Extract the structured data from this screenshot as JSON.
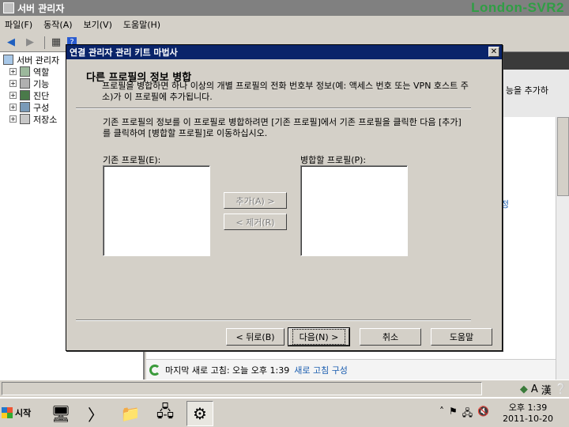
{
  "window": {
    "title": "서버 관리자",
    "watermark": "London-SVR2"
  },
  "menu": [
    "파일(F)",
    "동작(A)",
    "보기(V)",
    "도움말(H)"
  ],
  "tree": {
    "root": "서버 관리자",
    "items": [
      "역할",
      "기능",
      "진단",
      "구성",
      "저장소"
    ]
  },
  "rightpane": {
    "band_text": "능을 추가하",
    "link_text": "정",
    "footer": {
      "refresh_text": "마지막 새로 고침: 오늘 오후 1:39",
      "configure_link": "새로 고침 구성"
    }
  },
  "dialog": {
    "title": "연결 관리자 관리 키트 마법사",
    "heading": "다른 프로필의 정보 병합",
    "description": "프로필을 병합하면 하나 이상의 개별 프로필의 전화 번호부 정보(예: 액세스 번호 또는 VPN 호스트 주소)가 이 프로필에 추가됩니다.",
    "instruction": "기존 프로필의 정보를 이 프로필로 병합하려면 [기존 프로필]에서 기존 프로필을 클릭한 다음 [추가]를 클릭하여 [병합할 프로필]로 이동하십시오.",
    "existing_label": "기존 프로필(E):",
    "merge_label": "병합할 프로필(P):",
    "add_button": "추가(A) >",
    "remove_button": "< 제거(R)",
    "back_button": "< 뒤로(B)",
    "next_button": "다음(N) >",
    "cancel_button": "취소",
    "help_button": "도움말"
  },
  "taskbar": {
    "start": "시작",
    "time": "오후 1:39",
    "date": "2011-10-20"
  },
  "colors": {
    "dialog_titlebar": "#0a246a",
    "watermark": "#2f9e44",
    "link": "#1a5db0"
  }
}
